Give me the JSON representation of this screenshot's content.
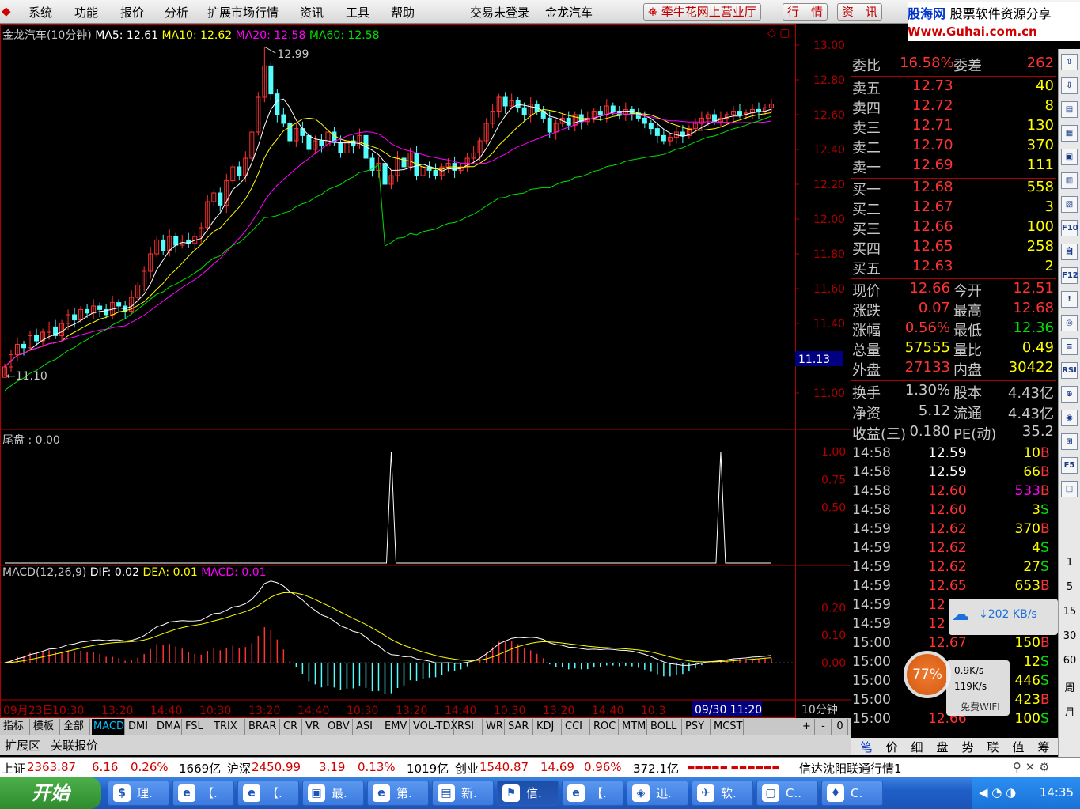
{
  "menu": {
    "items": [
      "系统",
      "功能",
      "报价",
      "分析",
      "扩展市场行情",
      "资讯",
      "工具",
      "帮助"
    ],
    "login_status": "交易未登录",
    "stock_name": "金龙汽车",
    "broker_button": "牵牛花网上营业厅",
    "quote_button": "行　情",
    "news_button": "资　讯"
  },
  "logo": {
    "name": "股海网",
    "tag": "股票软件资源分享",
    "url": "Www.Guhai.com.cn"
  },
  "chart": {
    "title": "金龙汽车(10分钟)",
    "ma5_label": "MA5: 12.61",
    "ma10_label": "MA10: 12.62",
    "ma20_label": "MA20: 12.58",
    "ma60_label": "MA60: 12.58",
    "high_marker": "12.99",
    "low_marker": "11.10",
    "current_tag": "11.13",
    "price_axis": [
      "13.00",
      "12.80",
      "12.60",
      "12.40",
      "12.20",
      "12.00",
      "11.80",
      "11.60",
      "11.40",
      "11.00"
    ],
    "tail_title": "尾盘 : 0.00",
    "tail_axis": [
      "1.00",
      "0.75",
      "0.50"
    ],
    "macd_title": "MACD(12,26,9)",
    "dif_label": "DIF: 0.02",
    "dea_label": "DEA: 0.01",
    "macd_label": "MACD: 0.01",
    "macd_axis": [
      "0.20",
      "0.10",
      "0.00"
    ],
    "time_axis": [
      "09月23日",
      "10:30",
      "13:20",
      "14:40",
      "10:30",
      "13:20",
      "14:40",
      "10:30",
      "13:20",
      "14:40",
      "10:30",
      "13:20",
      "14:40",
      "10:3",
      "14:40"
    ],
    "cursor_time": "09/30 11:20",
    "period_label": "10分钟",
    "colors": {
      "up": "#ff3232",
      "down": "#54fcfc",
      "ma5": "#ffffff",
      "ma10": "#ffff00",
      "ma20": "#ff00ff",
      "ma60": "#00e000",
      "axis": "#b00000"
    }
  },
  "chart_data": {
    "type": "candlestick",
    "title": "金龙汽车(10分钟)",
    "price_range": [
      11.0,
      13.0
    ],
    "close": [
      11.15,
      11.22,
      11.28,
      11.26,
      11.33,
      11.3,
      11.35,
      11.38,
      11.33,
      11.4,
      11.45,
      11.42,
      11.48,
      11.46,
      11.5,
      11.48,
      11.45,
      11.52,
      11.5,
      11.47,
      11.55,
      11.62,
      11.7,
      11.8,
      11.88,
      11.82,
      11.9,
      11.85,
      11.88,
      11.86,
      11.9,
      11.95,
      12.1,
      12.15,
      12.08,
      12.22,
      12.3,
      12.25,
      12.35,
      12.5,
      12.7,
      12.88,
      12.72,
      12.6,
      12.55,
      12.45,
      12.52,
      12.48,
      12.4,
      12.45,
      12.42,
      12.5,
      12.44,
      12.38,
      12.45,
      12.42,
      12.48,
      12.35,
      12.28,
      12.32,
      12.2,
      12.25,
      12.35,
      12.3,
      12.38,
      12.25,
      12.3,
      12.28,
      12.25,
      12.3,
      12.32,
      12.28,
      12.3,
      12.35,
      12.38,
      12.45,
      12.55,
      12.62,
      12.7,
      12.65,
      12.68,
      12.64,
      12.6,
      12.66,
      12.62,
      12.58,
      12.5,
      12.55,
      12.58,
      12.54,
      12.6,
      12.56,
      12.58,
      12.62,
      12.6,
      12.65,
      12.62,
      12.6,
      12.63,
      12.61,
      12.58,
      12.55,
      12.52,
      12.48,
      12.45,
      12.47,
      12.5,
      12.48,
      12.52,
      12.55,
      12.58,
      12.6,
      12.56,
      12.58,
      12.6,
      12.62,
      12.6,
      12.61,
      12.63,
      12.62,
      12.64,
      12.66
    ],
    "tail_spikes": [
      {
        "index": 61,
        "value": 1.0
      },
      {
        "index": 113,
        "value": 1.0
      }
    ],
    "dif_last": 0.02,
    "dea_last": 0.01,
    "macd_last": 0.01
  },
  "quote": {
    "weibi_label": "委比",
    "weibi_value": "16.58%",
    "weicha_label": "委差",
    "weicha_value": "262",
    "asks": [
      {
        "label": "卖五",
        "price": "12.73",
        "vol": "40"
      },
      {
        "label": "卖四",
        "price": "12.72",
        "vol": "8"
      },
      {
        "label": "卖三",
        "price": "12.71",
        "vol": "130"
      },
      {
        "label": "卖二",
        "price": "12.70",
        "vol": "370"
      },
      {
        "label": "卖一",
        "price": "12.69",
        "vol": "111"
      }
    ],
    "bids": [
      {
        "label": "买一",
        "price": "12.68",
        "vol": "558"
      },
      {
        "label": "买二",
        "price": "12.67",
        "vol": "3"
      },
      {
        "label": "买三",
        "price": "12.66",
        "vol": "100"
      },
      {
        "label": "买四",
        "price": "12.65",
        "vol": "258"
      },
      {
        "label": "买五",
        "price": "12.63",
        "vol": "2"
      }
    ],
    "stats": [
      {
        "l1": "现价",
        "v1": "12.66",
        "l2": "今开",
        "v2": "12.51"
      },
      {
        "l1": "涨跌",
        "v1": "0.07",
        "l2": "最高",
        "v2": "12.68"
      },
      {
        "l1": "涨幅",
        "v1": "0.56%",
        "l2": "最低",
        "v2": "12.36"
      },
      {
        "l1": "总量",
        "v1": "57555",
        "l2": "量比",
        "v2": "0.49"
      },
      {
        "l1": "外盘",
        "v1": "27133",
        "l2": "内盘",
        "v2": "30422"
      }
    ],
    "fund": [
      {
        "l1": "换手",
        "v1": "1.30%",
        "l2": "股本",
        "v2": "4.43亿"
      },
      {
        "l1": "净资",
        "v1": "5.12",
        "l2": "流通",
        "v2": "4.43亿"
      },
      {
        "l1": "收益(三)",
        "v1": "0.180",
        "l2": "PE(动)",
        "v2": "35.2"
      }
    ]
  },
  "ticks": [
    {
      "t": "14:58",
      "p": "12.59",
      "v": "10",
      "s": "B"
    },
    {
      "t": "14:58",
      "p": "12.59",
      "v": "66",
      "s": "B"
    },
    {
      "t": "14:58",
      "p": "12.60",
      "v": "533",
      "s": "B"
    },
    {
      "t": "14:58",
      "p": "12.60",
      "v": "3",
      "s": "S"
    },
    {
      "t": "14:59",
      "p": "12.62",
      "v": "370",
      "s": "B"
    },
    {
      "t": "14:59",
      "p": "12.62",
      "v": "4",
      "s": "S"
    },
    {
      "t": "14:59",
      "p": "12.62",
      "v": "27",
      "s": "S"
    },
    {
      "t": "14:59",
      "p": "12.65",
      "v": "653",
      "s": "B"
    },
    {
      "t": "14:59",
      "p": "12",
      "v": "",
      "s": ""
    },
    {
      "t": "14:59",
      "p": "12",
      "v": "",
      "s": ""
    },
    {
      "t": "15:00",
      "p": "12.67",
      "v": "150",
      "s": "B"
    },
    {
      "t": "15:00",
      "p": "",
      "v": "12",
      "s": "S"
    },
    {
      "t": "15:00",
      "p": "",
      "v": "446",
      "s": "S"
    },
    {
      "t": "15:00",
      "p": "",
      "v": "423",
      "s": "B"
    },
    {
      "t": "15:00",
      "p": "12.66",
      "v": "100",
      "s": "S"
    }
  ],
  "overlays": {
    "net_speed": "↓202 KB/s",
    "gauge": "77%",
    "up_speed": "0.9K/s",
    "down_speed": "119K/s",
    "wifi": "免费WIFI"
  },
  "sidebar": {
    "icons": [
      "⇧",
      "⇩",
      "▤",
      "▦",
      "▣",
      "▥",
      "▧",
      "F10",
      "自",
      "F12",
      "!",
      "◎",
      "≡",
      "RSI",
      "⊕",
      "◉",
      "⊞",
      "F5",
      "□"
    ],
    "nums": [
      "1",
      "5",
      "15",
      "30",
      "60",
      "周",
      "月"
    ]
  },
  "period_tabs": [
    "笔",
    "价",
    "细",
    "盘",
    "势",
    "联",
    "值",
    "筹"
  ],
  "indicator_tabs": [
    "指标",
    "模板",
    "全部",
    "MACD",
    "DMI",
    "DMA",
    "FSL",
    "TRIX",
    "BRAR",
    "CR",
    "VR",
    "OBV",
    "ASI",
    "EMV",
    "VOL-TDX",
    "RSI",
    "WR",
    "SAR",
    "KDJ",
    "CCI",
    "ROC",
    "MTM",
    "BOLL",
    "PSY",
    "MCST"
  ],
  "indicator_controls": [
    "+",
    "-",
    "0"
  ],
  "bottom_tabs": [
    "扩展区",
    "关联报价"
  ],
  "status": {
    "sh_label": "上证",
    "sh_value": "2363.87",
    "sh_chg": "6.16",
    "sh_pct": "0.26%",
    "sh_amt": "1669亿",
    "hs_label": "沪深",
    "hs_value": "2450.99",
    "hs_chg": "3.19",
    "hs_pct": "0.13%",
    "hs_amt": "1019亿",
    "cy_label": "创业",
    "cy_value": "1540.87",
    "cy_chg": "14.69",
    "cy_pct": "0.96%",
    "cy_amt": "372.1亿",
    "server": "信达沈阳联通行情1"
  },
  "taskbar": {
    "start": "开始",
    "buttons": [
      "理.",
      "【.",
      "【.",
      "最.",
      "第.",
      "新.",
      "信.",
      "【.",
      "迅.",
      "软.",
      "C..",
      "C."
    ],
    "clock": "14:35"
  }
}
